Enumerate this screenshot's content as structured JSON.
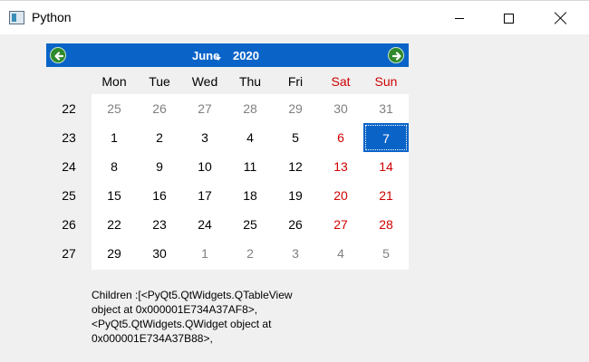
{
  "window": {
    "title": "Python"
  },
  "calendar": {
    "month": "June",
    "year": "2020",
    "weekdays": [
      {
        "label": "Mon",
        "weekend": false
      },
      {
        "label": "Tue",
        "weekend": false
      },
      {
        "label": "Wed",
        "weekend": false
      },
      {
        "label": "Thu",
        "weekend": false
      },
      {
        "label": "Fri",
        "weekend": false
      },
      {
        "label": "Sat",
        "weekend": true
      },
      {
        "label": "Sun",
        "weekend": true
      }
    ],
    "weeks": [
      {
        "number": "22",
        "days": [
          {
            "d": "25",
            "other": true
          },
          {
            "d": "26",
            "other": true
          },
          {
            "d": "27",
            "other": true
          },
          {
            "d": "28",
            "other": true
          },
          {
            "d": "29",
            "other": true
          },
          {
            "d": "30",
            "other": true
          },
          {
            "d": "31",
            "other": true
          }
        ]
      },
      {
        "number": "23",
        "days": [
          {
            "d": "1"
          },
          {
            "d": "2"
          },
          {
            "d": "3"
          },
          {
            "d": "4"
          },
          {
            "d": "5"
          },
          {
            "d": "6"
          },
          {
            "d": "7",
            "selected": true
          }
        ]
      },
      {
        "number": "24",
        "days": [
          {
            "d": "8"
          },
          {
            "d": "9"
          },
          {
            "d": "10"
          },
          {
            "d": "11"
          },
          {
            "d": "12"
          },
          {
            "d": "13"
          },
          {
            "d": "14"
          }
        ]
      },
      {
        "number": "25",
        "days": [
          {
            "d": "15"
          },
          {
            "d": "16"
          },
          {
            "d": "17"
          },
          {
            "d": "18"
          },
          {
            "d": "19"
          },
          {
            "d": "20"
          },
          {
            "d": "21"
          }
        ]
      },
      {
        "number": "26",
        "days": [
          {
            "d": "22"
          },
          {
            "d": "23"
          },
          {
            "d": "24"
          },
          {
            "d": "25"
          },
          {
            "d": "26"
          },
          {
            "d": "27"
          },
          {
            "d": "28"
          }
        ]
      },
      {
        "number": "27",
        "days": [
          {
            "d": "29"
          },
          {
            "d": "30"
          },
          {
            "d": "1",
            "other": true
          },
          {
            "d": "2",
            "other": true
          },
          {
            "d": "3",
            "other": true
          },
          {
            "d": "4",
            "other": true
          },
          {
            "d": "5",
            "other": true
          }
        ]
      }
    ],
    "colors": {
      "header_bg": "#0a64c8",
      "weekend": "#d00000",
      "other_month": "#808080",
      "selected_bg": "#0a64c8",
      "nav_arrow": "#2f8a2c"
    },
    "icons": {
      "prev": "arrow-left-icon",
      "next": "arrow-right-icon"
    }
  },
  "children": {
    "lines": [
      "Children :[<PyQt5.QtWidgets.QTableView",
      "object at 0x000001E734A37AF8>,",
      "<PyQt5.QtWidgets.QWidget object at",
      "0x000001E734A37B88>,"
    ]
  }
}
